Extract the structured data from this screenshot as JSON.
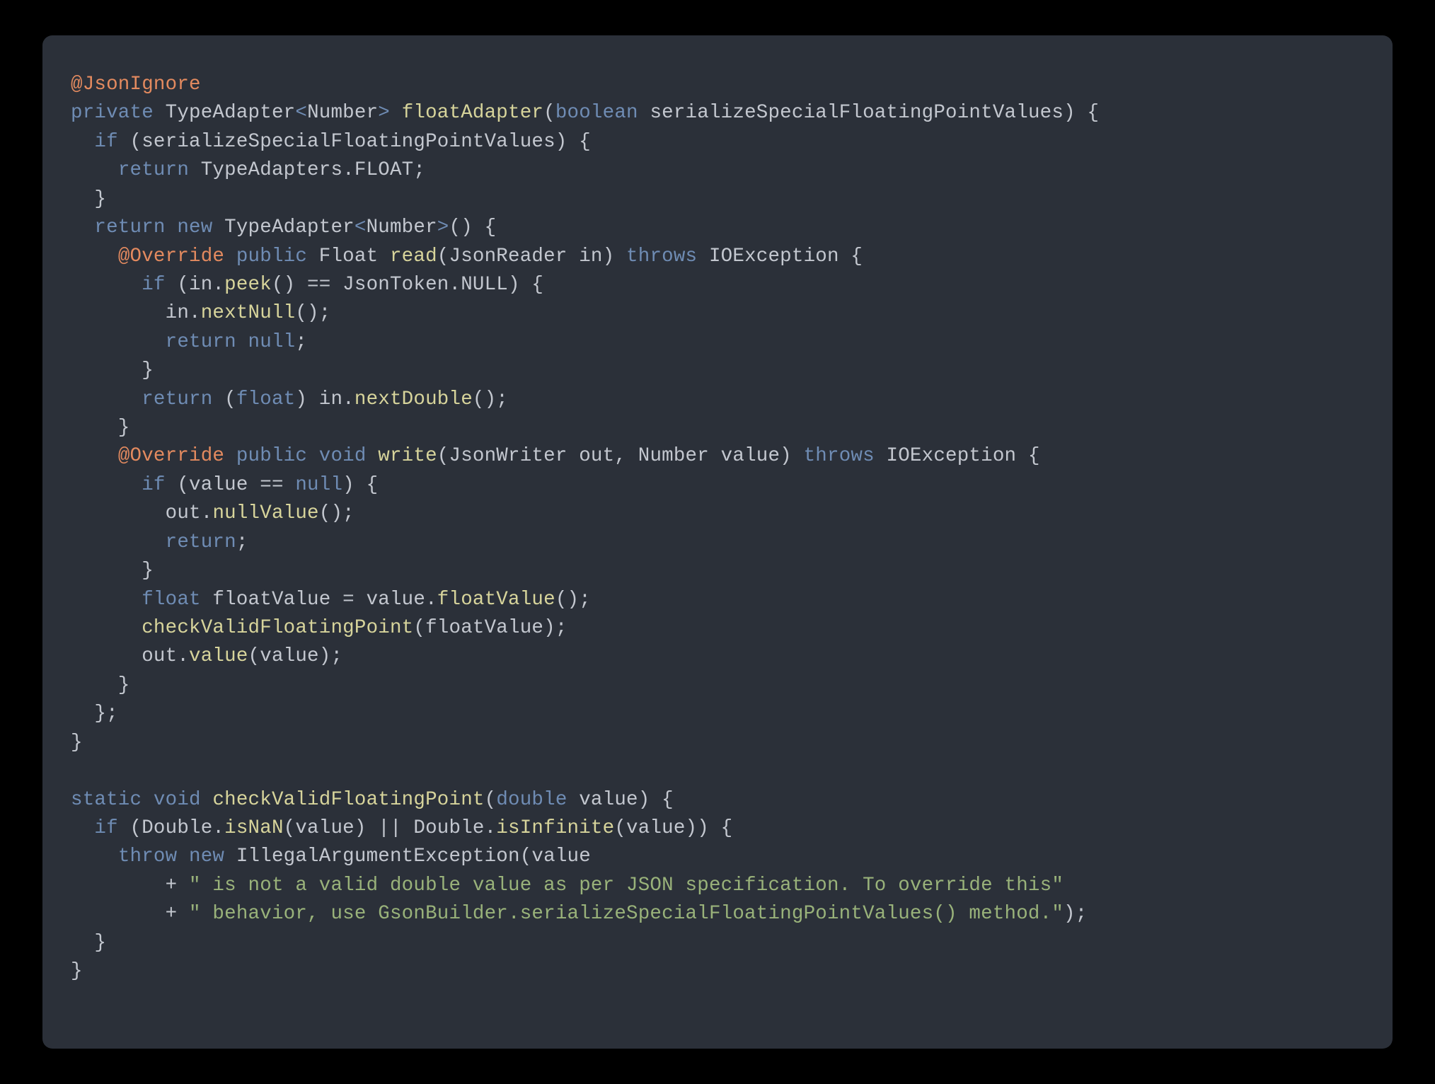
{
  "language": "java",
  "code": {
    "lines": [
      [
        {
          "t": "@JsonIgnore",
          "c": "tok-annotation"
        }
      ],
      [
        {
          "t": "private",
          "c": "tok-keyword"
        },
        {
          "t": " "
        },
        {
          "t": "TypeAdapter",
          "c": "tok-type"
        },
        {
          "t": "<",
          "c": "tok-generic"
        },
        {
          "t": "Number",
          "c": "tok-type"
        },
        {
          "t": ">",
          "c": "tok-generic"
        },
        {
          "t": " "
        },
        {
          "t": "floatAdapter",
          "c": "tok-method-def"
        },
        {
          "t": "(",
          "c": "tok-punct"
        },
        {
          "t": "boolean",
          "c": "tok-keyword"
        },
        {
          "t": " "
        },
        {
          "t": "serializeSpecialFloatingPointValues",
          "c": "tok-param"
        },
        {
          "t": ") {",
          "c": "tok-punct"
        }
      ],
      [
        {
          "t": "  "
        },
        {
          "t": "if",
          "c": "tok-keyword"
        },
        {
          "t": " (serializeSpecialFloatingPointValues) {",
          "c": "tok-punct"
        }
      ],
      [
        {
          "t": "    "
        },
        {
          "t": "return",
          "c": "tok-keyword"
        },
        {
          "t": " TypeAdapters.FLOAT;",
          "c": "tok-punct"
        }
      ],
      [
        {
          "t": "  }",
          "c": "tok-punct"
        }
      ],
      [
        {
          "t": "  "
        },
        {
          "t": "return",
          "c": "tok-keyword"
        },
        {
          "t": " "
        },
        {
          "t": "new",
          "c": "tok-keyword"
        },
        {
          "t": " "
        },
        {
          "t": "TypeAdapter",
          "c": "tok-type"
        },
        {
          "t": "<",
          "c": "tok-generic"
        },
        {
          "t": "Number",
          "c": "tok-type"
        },
        {
          "t": ">",
          "c": "tok-generic"
        },
        {
          "t": "() {",
          "c": "tok-punct"
        }
      ],
      [
        {
          "t": "    "
        },
        {
          "t": "@Override",
          "c": "tok-annotation"
        },
        {
          "t": " "
        },
        {
          "t": "public",
          "c": "tok-keyword"
        },
        {
          "t": " "
        },
        {
          "t": "Float",
          "c": "tok-type"
        },
        {
          "t": " "
        },
        {
          "t": "read",
          "c": "tok-method-def"
        },
        {
          "t": "(JsonReader in) ",
          "c": "tok-punct"
        },
        {
          "t": "throws",
          "c": "tok-keyword"
        },
        {
          "t": " IOException {",
          "c": "tok-punct"
        }
      ],
      [
        {
          "t": "      "
        },
        {
          "t": "if",
          "c": "tok-keyword"
        },
        {
          "t": " (in.",
          "c": "tok-punct"
        },
        {
          "t": "peek",
          "c": "tok-method-call"
        },
        {
          "t": "() == JsonToken.NULL) {",
          "c": "tok-punct"
        }
      ],
      [
        {
          "t": "        in."
        },
        {
          "t": "nextNull",
          "c": "tok-method-call"
        },
        {
          "t": "();",
          "c": "tok-punct"
        }
      ],
      [
        {
          "t": "        "
        },
        {
          "t": "return",
          "c": "tok-keyword"
        },
        {
          "t": " "
        },
        {
          "t": "null",
          "c": "tok-null"
        },
        {
          "t": ";",
          "c": "tok-punct"
        }
      ],
      [
        {
          "t": "      }",
          "c": "tok-punct"
        }
      ],
      [
        {
          "t": "      "
        },
        {
          "t": "return",
          "c": "tok-keyword"
        },
        {
          "t": " ("
        },
        {
          "t": "float",
          "c": "tok-float"
        },
        {
          "t": ") in."
        },
        {
          "t": "nextDouble",
          "c": "tok-method-call"
        },
        {
          "t": "();",
          "c": "tok-punct"
        }
      ],
      [
        {
          "t": "    }",
          "c": "tok-punct"
        }
      ],
      [
        {
          "t": "    "
        },
        {
          "t": "@Override",
          "c": "tok-annotation"
        },
        {
          "t": " "
        },
        {
          "t": "public",
          "c": "tok-keyword"
        },
        {
          "t": " "
        },
        {
          "t": "void",
          "c": "tok-keyword"
        },
        {
          "t": " "
        },
        {
          "t": "write",
          "c": "tok-method-def"
        },
        {
          "t": "(JsonWriter out, Number value) ",
          "c": "tok-punct"
        },
        {
          "t": "throws",
          "c": "tok-keyword"
        },
        {
          "t": " IOException {",
          "c": "tok-punct"
        }
      ],
      [
        {
          "t": "      "
        },
        {
          "t": "if",
          "c": "tok-keyword"
        },
        {
          "t": " (value == ",
          "c": "tok-punct"
        },
        {
          "t": "null",
          "c": "tok-null"
        },
        {
          "t": ") {",
          "c": "tok-punct"
        }
      ],
      [
        {
          "t": "        out."
        },
        {
          "t": "nullValue",
          "c": "tok-method-call"
        },
        {
          "t": "();",
          "c": "tok-punct"
        }
      ],
      [
        {
          "t": "        "
        },
        {
          "t": "return",
          "c": "tok-keyword"
        },
        {
          "t": ";",
          "c": "tok-punct"
        }
      ],
      [
        {
          "t": "      }",
          "c": "tok-punct"
        }
      ],
      [
        {
          "t": "      "
        },
        {
          "t": "float",
          "c": "tok-float"
        },
        {
          "t": " floatValue = value."
        },
        {
          "t": "floatValue",
          "c": "tok-method-call"
        },
        {
          "t": "();",
          "c": "tok-punct"
        }
      ],
      [
        {
          "t": "      "
        },
        {
          "t": "checkValidFloatingPoint",
          "c": "tok-method-call"
        },
        {
          "t": "(floatValue);",
          "c": "tok-punct"
        }
      ],
      [
        {
          "t": "      out."
        },
        {
          "t": "value",
          "c": "tok-method-call"
        },
        {
          "t": "(value);",
          "c": "tok-punct"
        }
      ],
      [
        {
          "t": "    }",
          "c": "tok-punct"
        }
      ],
      [
        {
          "t": "  };",
          "c": "tok-punct"
        }
      ],
      [
        {
          "t": "}",
          "c": "tok-punct"
        }
      ],
      [
        {
          "t": ""
        }
      ],
      [
        {
          "t": "static",
          "c": "tok-keyword"
        },
        {
          "t": " "
        },
        {
          "t": "void",
          "c": "tok-keyword"
        },
        {
          "t": " "
        },
        {
          "t": "checkValidFloatingPoint",
          "c": "tok-method-def"
        },
        {
          "t": "(",
          "c": "tok-punct"
        },
        {
          "t": "double",
          "c": "tok-keyword"
        },
        {
          "t": " value) {",
          "c": "tok-punct"
        }
      ],
      [
        {
          "t": "  "
        },
        {
          "t": "if",
          "c": "tok-keyword"
        },
        {
          "t": " (Double.",
          "c": "tok-punct"
        },
        {
          "t": "isNaN",
          "c": "tok-method-call"
        },
        {
          "t": "(value) || Double.",
          "c": "tok-punct"
        },
        {
          "t": "isInfinite",
          "c": "tok-method-call"
        },
        {
          "t": "(value)) {",
          "c": "tok-punct"
        }
      ],
      [
        {
          "t": "    "
        },
        {
          "t": "throw",
          "c": "tok-keyword"
        },
        {
          "t": " "
        },
        {
          "t": "new",
          "c": "tok-keyword"
        },
        {
          "t": " "
        },
        {
          "t": "IllegalArgumentException",
          "c": "tok-type"
        },
        {
          "t": "(value",
          "c": "tok-punct"
        }
      ],
      [
        {
          "t": "        + "
        },
        {
          "t": "\" is not a valid double value as per JSON specification. To override this\"",
          "c": "tok-string"
        }
      ],
      [
        {
          "t": "        + "
        },
        {
          "t": "\" behavior, use GsonBuilder.serializeSpecialFloatingPointValues() method.\"",
          "c": "tok-string"
        },
        {
          "t": ");",
          "c": "tok-punct"
        }
      ],
      [
        {
          "t": "  }",
          "c": "tok-punct"
        }
      ],
      [
        {
          "t": "}",
          "c": "tok-punct"
        }
      ]
    ]
  }
}
